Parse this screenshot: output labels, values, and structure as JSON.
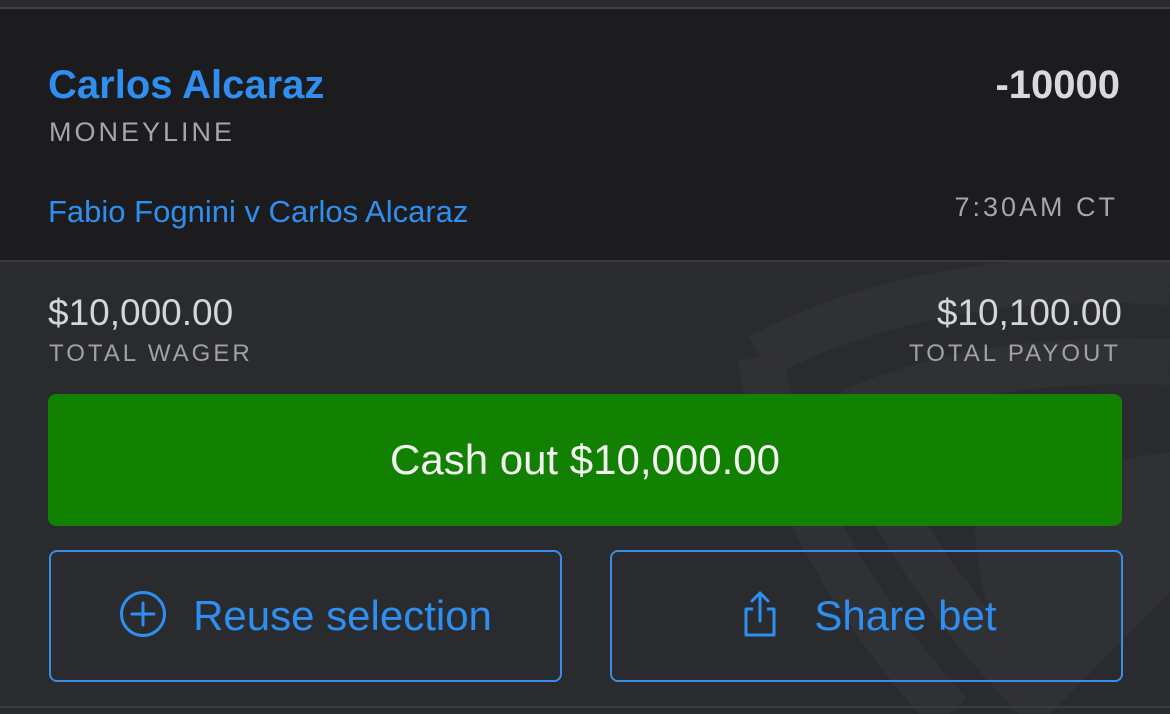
{
  "bet": {
    "selection": "Carlos Alcaraz",
    "odds": "-10000",
    "market_type": "MONEYLINE",
    "event": "Fabio Fognini v Carlos Alcaraz",
    "time": "7:30AM CT"
  },
  "totals": {
    "wager_amount": "$10,000.00",
    "wager_label": "TOTAL WAGER",
    "payout_amount": "$10,100.00",
    "payout_label": "TOTAL PAYOUT"
  },
  "actions": {
    "cashout_label": "Cash out $10,000.00",
    "reuse_label": "Reuse selection",
    "reuse_icon": "plus-circle-icon",
    "share_label": "Share bet",
    "share_icon": "share-icon"
  },
  "colors": {
    "accent_blue": "#2f8ff0",
    "cashout_green": "#128000",
    "header_bg": "#1c1c1e",
    "body_bg": "#2a2b2e"
  }
}
